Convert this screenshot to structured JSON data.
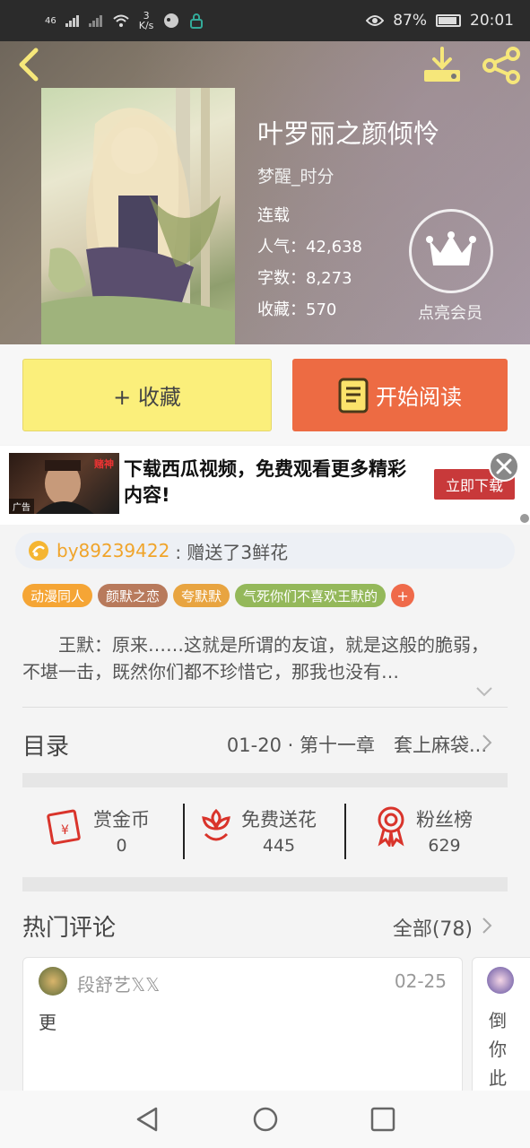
{
  "status_bar": {
    "signal_label": "46",
    "net_speed_value": "3",
    "net_speed_unit": "K/s",
    "battery": "87%",
    "time": "20:01"
  },
  "header": {
    "back_icon": "chevron-left-icon",
    "download_icon": "download-icon",
    "share_icon": "share-icon"
  },
  "book": {
    "title": "叶罗丽之颜倾怜",
    "author": "梦醒_时分",
    "status": "连载",
    "popularity": "人气：42,638",
    "word_count": "字数：8,273",
    "favorites": "收藏：570",
    "vip_label": "点亮会员"
  },
  "actions": {
    "favorite_label": "+ 收藏",
    "read_label": "开始阅读"
  },
  "ad": {
    "text": "下载西瓜视频，免费观看更多精彩内容!",
    "cta": "立即下载",
    "tag": "广告",
    "brand": "赌神"
  },
  "gift": {
    "user": "by89239422",
    "text": ": 赠送了3鲜花"
  },
  "tags": [
    {
      "label": "动漫同人",
      "color": "#f5a535"
    },
    {
      "label": "颜默之恋",
      "color": "#b87a5c"
    },
    {
      "label": "夸默默",
      "color": "#e8a440"
    },
    {
      "label": "气死你们不喜欢王默的",
      "color": "#94b85a"
    }
  ],
  "tag_add": "+",
  "synopsis": "王默：原来……这就是所谓的友谊，就是这般的脆弱，不堪一击，既然你们都不珍惜它，那我也没有…",
  "toc": {
    "title": "目录",
    "latest": "01-20 · 第十一章　套上麻袋..."
  },
  "stats": [
    {
      "label": "赏金币",
      "value": "0",
      "icon": "red-envelope-icon"
    },
    {
      "label": "免费送花",
      "value": "445",
      "icon": "flower-icon"
    },
    {
      "label": "粉丝榜",
      "value": "629",
      "icon": "medal-icon"
    }
  ],
  "hot_comments": {
    "title": "热门评论",
    "all_label": "全部(78)",
    "items": [
      {
        "name": "段舒艺𝕏𝕏",
        "date": "02-25",
        "body": "更"
      }
    ],
    "peek_text": "倒你此"
  },
  "nav": {
    "back": "back-triangle-icon",
    "home": "home-circle-icon",
    "recent": "recent-square-icon"
  },
  "colors": {
    "accent_orange": "#ed6b43",
    "favorite_yellow": "#fbef7b",
    "gift_user": "#f0a42a",
    "icon_red": "#d9342b"
  }
}
